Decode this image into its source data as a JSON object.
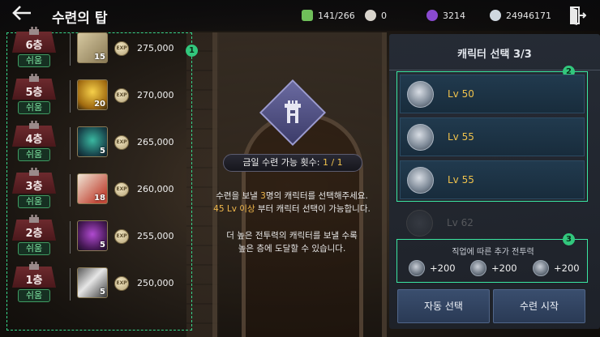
{
  "header": {
    "title": "수련의 탑",
    "currencies": [
      {
        "icon": "energy-icon",
        "value": "141/266",
        "color": "#6fbf5a"
      },
      {
        "icon": "pearl-icon",
        "value": "0",
        "color": "#d8d4cc"
      },
      {
        "icon": "purple-gem-icon",
        "value": "3214",
        "color": "#8a4ad0"
      },
      {
        "icon": "silver-coin-icon",
        "value": "24946171",
        "color": "#cfd8e0"
      }
    ]
  },
  "annotations": {
    "badge1": "1",
    "badge2": "2",
    "badge3": "3"
  },
  "floors": [
    {
      "label": "6층",
      "difficulty": "쉬움",
      "item_count": "15",
      "exp_label": "EXP",
      "amount": "275,000",
      "item_color": "#b8a67a"
    },
    {
      "label": "5층",
      "difficulty": "쉬움",
      "item_count": "20",
      "exp_label": "EXP",
      "amount": "270,000",
      "item_color": "#d6a21a"
    },
    {
      "label": "4층",
      "difficulty": "쉬움",
      "item_count": "5",
      "exp_label": "EXP",
      "amount": "265,000",
      "item_color": "#2a8a7a"
    },
    {
      "label": "3층",
      "difficulty": "쉬움",
      "item_count": "18",
      "exp_label": "EXP",
      "amount": "260,000",
      "item_color": "#c24a3a"
    },
    {
      "label": "2층",
      "difficulty": "쉬움",
      "item_count": "5",
      "exp_label": "EXP",
      "amount": "255,000",
      "item_color": "#7a2a8a"
    },
    {
      "label": "1층",
      "difficulty": "쉬움",
      "item_count": "5",
      "exp_label": "EXP",
      "amount": "250,000",
      "item_color": "#c8c8c8"
    }
  ],
  "center": {
    "entries_label": "금일 수련 가능 횟수: ",
    "entries_value": "1 / 1",
    "line1_pre": "수련을 보낼 ",
    "line1_hl": "3",
    "line1_post": "명의 캐릭터를 선택해주세요.",
    "line2_hl": "45 Lv 이상",
    "line2_post": " 부터 캐릭터 선택이 가능합니다.",
    "line3": "더 높은 전투력의 캐릭터를 보낼 수록",
    "line4": "높은 층에 도달할 수 있습니다."
  },
  "panel": {
    "title": "캐릭터 선택 3/3",
    "characters": [
      {
        "level": "Lv 50",
        "icon": "sword-class-icon"
      },
      {
        "level": "Lv 55",
        "icon": "knot-class-icon"
      },
      {
        "level": "Lv 55",
        "icon": "flower-class-icon"
      },
      {
        "level": "Lv 62",
        "icon": "locked-class-icon"
      }
    ],
    "bonus_title": "직업에 따른 추가 전투력",
    "bonuses": [
      {
        "value": "+200",
        "icon": "sword-class-icon"
      },
      {
        "value": "+200",
        "icon": "knot-class-icon"
      },
      {
        "value": "+200",
        "icon": "flower-class-icon"
      }
    ],
    "auto_select_label": "자동 선택",
    "start_label": "수련 시작"
  }
}
